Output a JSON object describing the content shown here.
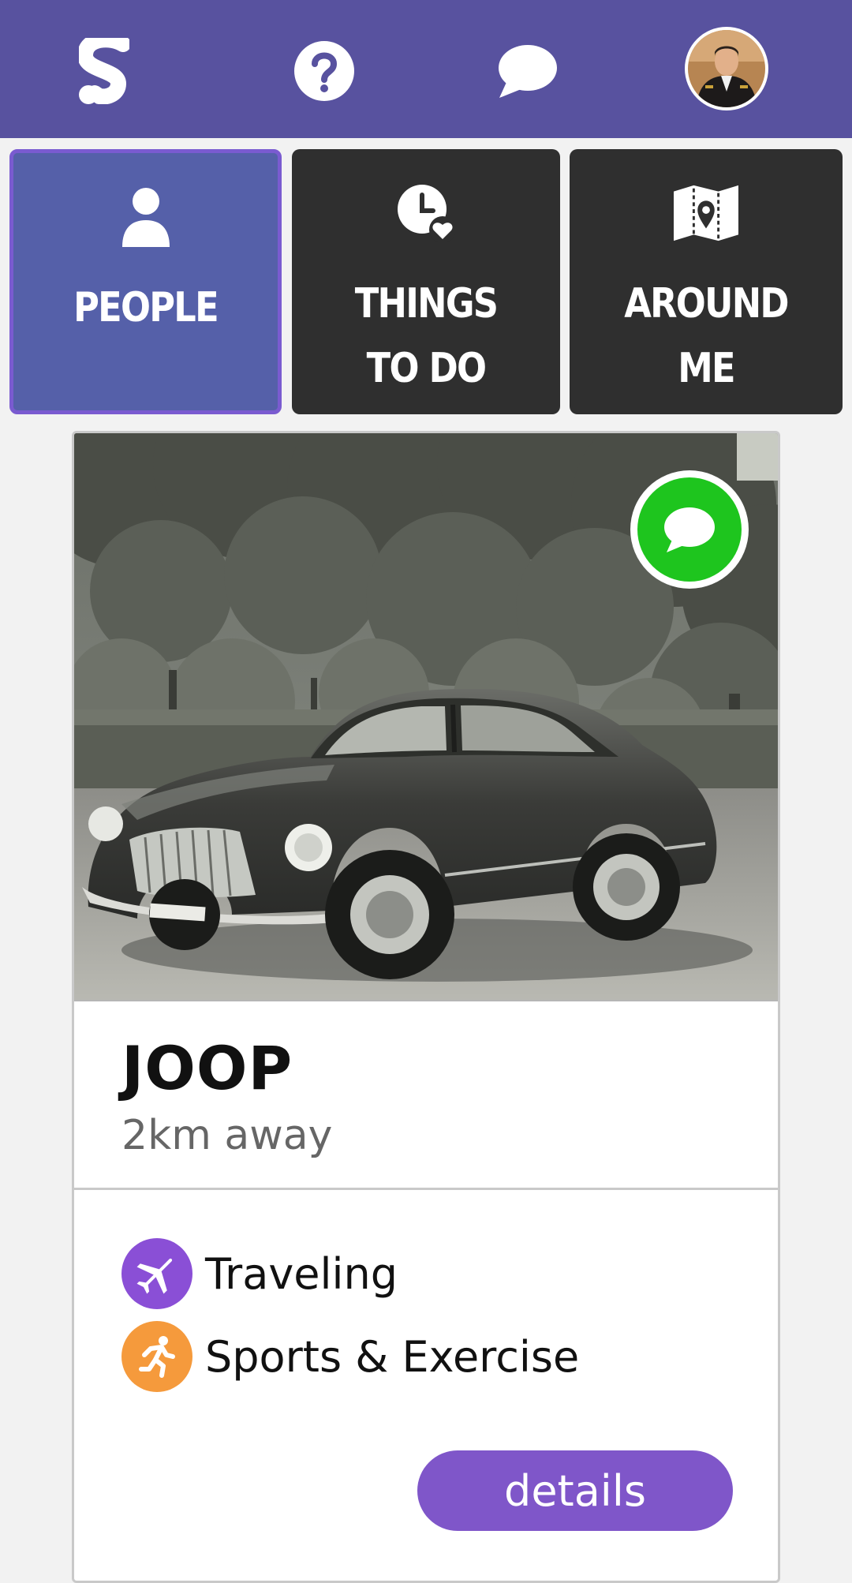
{
  "topbar": {
    "logo": "S",
    "icons": [
      "logo-icon",
      "help-icon",
      "chat-icon",
      "avatar"
    ],
    "color": "#58529f"
  },
  "tabs": [
    {
      "label": "PEOPLE",
      "icon": "person-icon",
      "active": true
    },
    {
      "label": "THINGS\nTO DO",
      "icon": "clock-heart-icon",
      "active": false
    },
    {
      "label": "AROUND\nME",
      "icon": "map-pin-icon",
      "active": false
    }
  ],
  "profile": {
    "name": "JOOP",
    "distance": "2km away",
    "photo": "vintage-car-photo",
    "interests": [
      {
        "label": "Traveling",
        "icon": "airplane-icon",
        "color": "#8a4fd6"
      },
      {
        "label": "Sports & Exercise",
        "icon": "runner-icon",
        "color": "#f59a3c"
      }
    ],
    "details_label": "details"
  },
  "colors": {
    "accent": "#7f56c9",
    "active_tab": "#5560a9",
    "tab_bg": "#2f2f2f",
    "message": "#1ec51e"
  }
}
